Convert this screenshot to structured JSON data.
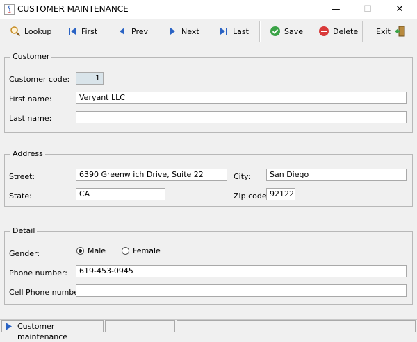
{
  "window": {
    "title": "CUSTOMER MAINTENANCE",
    "minimize": "—",
    "maximize": "☐",
    "close": "✕"
  },
  "toolbar": {
    "lookup": "Lookup",
    "first": "First",
    "prev": "Prev",
    "next": "Next",
    "last": "Last",
    "save": "Save",
    "delete": "Delete",
    "exit": "Exit"
  },
  "customer": {
    "legend": "Customer",
    "code_label": "Customer code:",
    "code_value": "1",
    "first_name_label": "First name:",
    "first_name_value": "Veryant LLC",
    "last_name_label": "Last name:",
    "last_name_value": ""
  },
  "address": {
    "legend": "Address",
    "street_label": "Street:",
    "street_value": "6390 Greenw ich Drive, Suite 22",
    "city_label": "City:",
    "city_value": "San Diego",
    "state_label": "State:",
    "state_value": "CA",
    "zip_label": "Zip code:",
    "zip_value": "92122"
  },
  "detail": {
    "legend": "Detail",
    "gender_label": "Gender:",
    "gender_options": [
      "Male",
      "Female"
    ],
    "gender_selected": "Male",
    "phone_label": "Phone number:",
    "phone_value": "619-453-0945",
    "cell_label": "Cell Phone number:",
    "cell_value": ""
  },
  "status": {
    "text": "Customer maintenance"
  },
  "colors": {
    "accent_blue": "#2a63c4",
    "save_green": "#3aa346",
    "delete_red": "#d93a3a"
  }
}
